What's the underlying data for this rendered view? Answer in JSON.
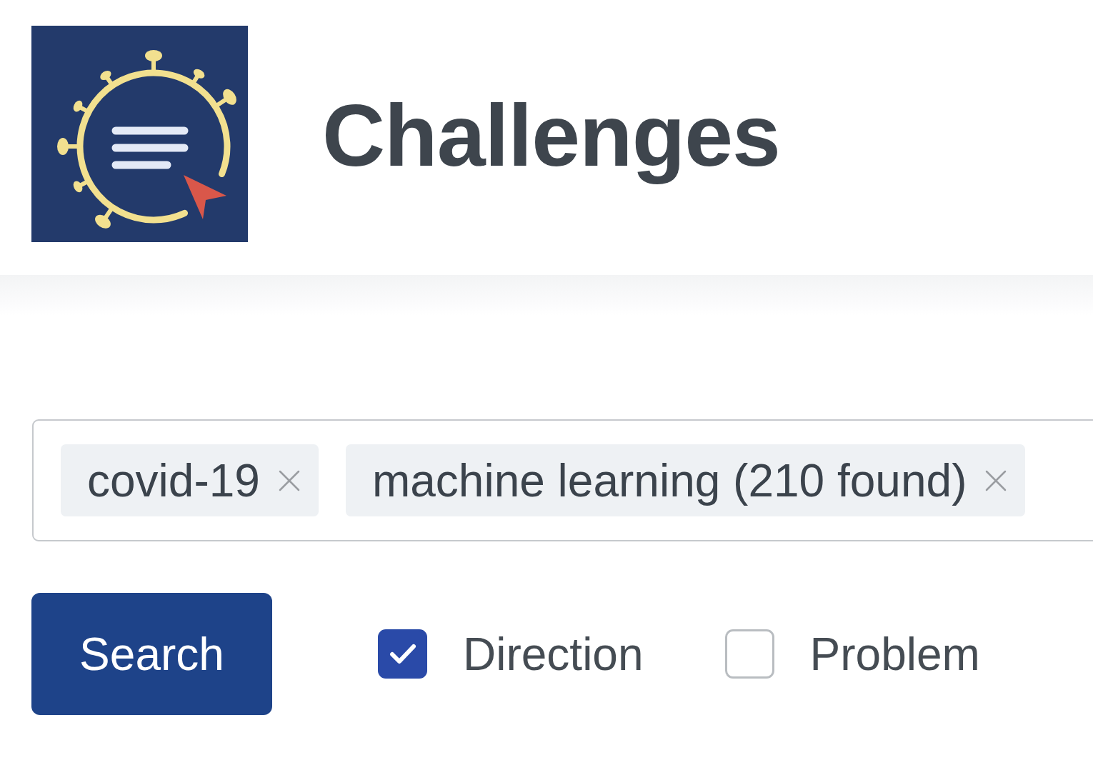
{
  "header": {
    "title": "Challenges"
  },
  "tag_input": {
    "tags": [
      {
        "label": "covid-19"
      },
      {
        "label": "machine learning (210 found)"
      }
    ]
  },
  "search_button": {
    "label": "Search"
  },
  "filters": [
    {
      "label": "Direction",
      "checked": true
    },
    {
      "label": "Problem",
      "checked": false
    }
  ]
}
